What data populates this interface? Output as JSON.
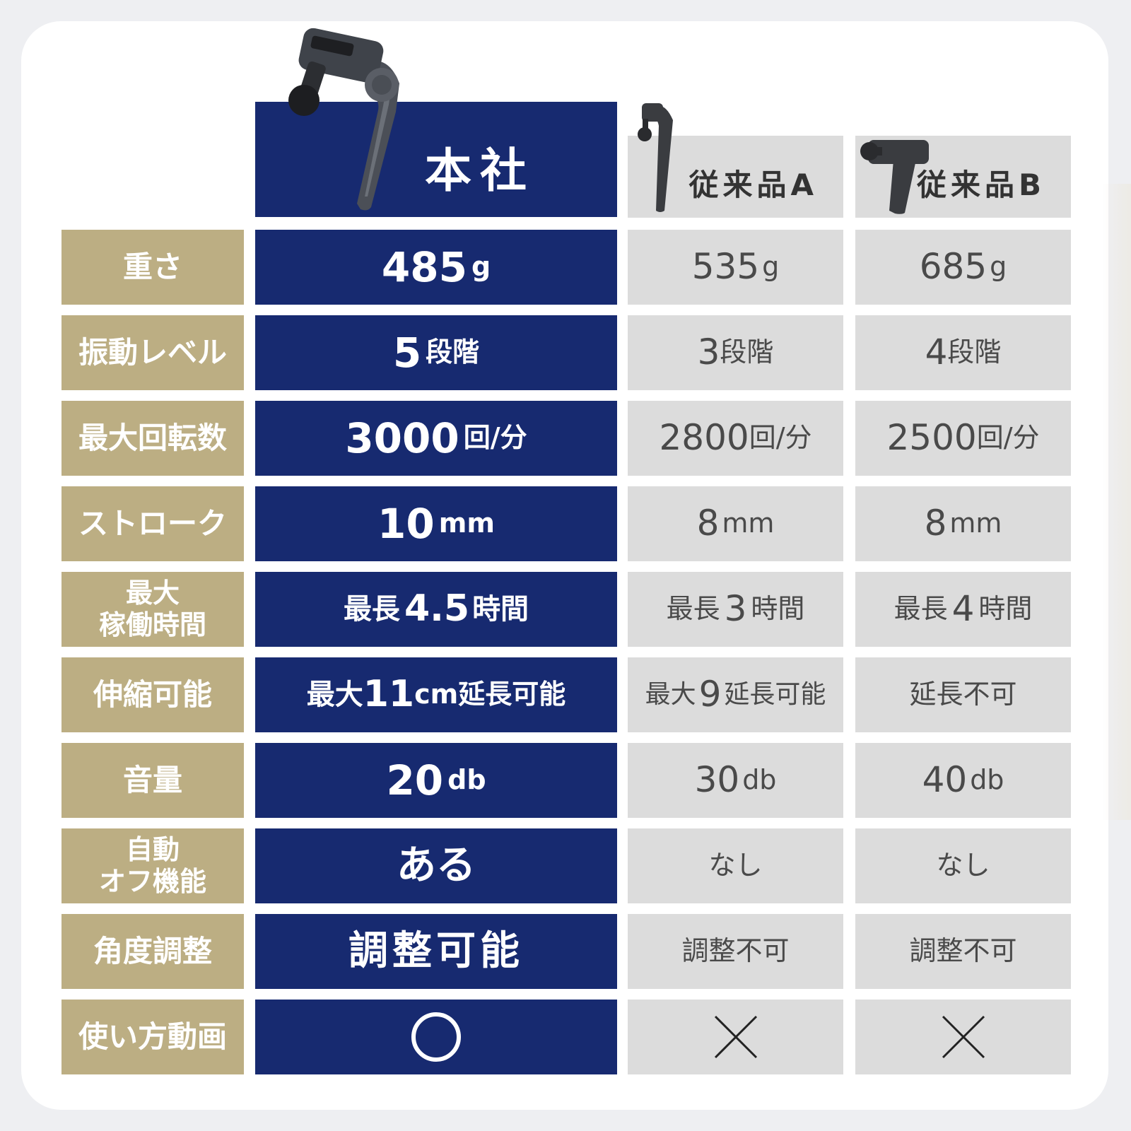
{
  "header": {
    "ours": "本社",
    "product_a": "従来品A",
    "product_b": "従来品B"
  },
  "rows": [
    {
      "label": "重さ",
      "ours_big": "485",
      "ours_unit": "g",
      "a_big": "535",
      "a_unit": "g",
      "b_big": "685",
      "b_unit": "g"
    },
    {
      "label": "振動レベル",
      "ours_big": "5",
      "ours_unit": "段階",
      "a_big": "3",
      "a_unit": "段階",
      "b_big": "4",
      "b_unit": "段階"
    },
    {
      "label": "最大回転数",
      "ours_big": "3000",
      "ours_unit": "回/分",
      "a_big": "2800",
      "a_unit": "回/分",
      "b_big": "2500",
      "b_unit": "回/分"
    },
    {
      "label": "ストローク",
      "ours_big": "10",
      "ours_unit": "mm",
      "a_big": "8",
      "a_unit": "mm",
      "b_big": "8",
      "b_unit": "mm"
    },
    {
      "label_line1": "最大",
      "label_line2": "稼働時間",
      "ours_pre": "最長",
      "ours_big": "4.5",
      "ours_unit": "時間",
      "a_pre": "最長",
      "a_big": "3",
      "a_unit": "時間",
      "b_pre": "最長",
      "b_big": "4",
      "b_unit": "時間"
    },
    {
      "label": "伸縮可能",
      "ours_pre": "最大",
      "ours_big": "11",
      "ours_unit": "cm延長可能",
      "a_pre": "最大",
      "a_big": "9",
      "a_unit": "延長可能",
      "b_text": "延長不可"
    },
    {
      "label": "音量",
      "ours_big": "20",
      "ours_unit": "db",
      "a_big": "30",
      "a_unit": "db",
      "b_big": "40",
      "b_unit": "db"
    },
    {
      "label_line1": "自動",
      "label_line2": "オフ機能",
      "ours_text": "ある",
      "a_text": "なし",
      "b_text": "なし"
    },
    {
      "label": "角度調整",
      "ours_text": "調整可能",
      "a_text": "調整不可",
      "b_text": "調整不可"
    },
    {
      "label": "使い方動画",
      "ours_icon": "circle-icon",
      "a_icon": "cross-icon",
      "b_icon": "cross-icon"
    }
  ]
}
